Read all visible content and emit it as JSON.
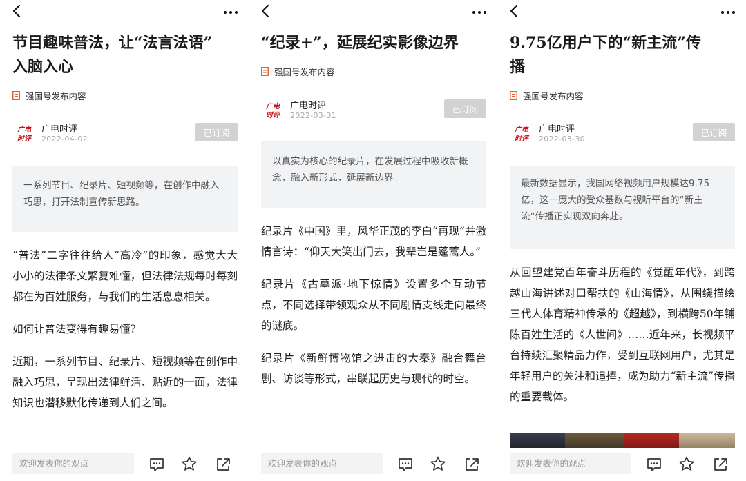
{
  "articles": [
    {
      "title_lines": [
        "节目趣味普法，让“法言法语”",
        "入脑入心"
      ],
      "source_label": "强国号发布内容",
      "author": {
        "name": "广电时评",
        "date": "2022-04-02",
        "avatar_text": [
          "广电",
          "时评"
        ]
      },
      "subscribe_label": "已订阅",
      "summary": "一系列节目、纪录片、短视频等，在创作中融入巧思，打开法制宣传新思路。",
      "paragraphs": [
        "“普法”二字往往给人“高冷”的印象，感觉大大小小的法律条文繁复难懂，但法律法规每时每刻都在为百姓服务，与我们的生活息息相关。",
        "如何让普法变得有趣易懂?",
        "近期，一系列节目、纪录片、短视频等在创作中融入巧思，呈现出法律鲜活、贴近的一面，法律知识也潜移默化传递到人们之间。"
      ],
      "comment_placeholder": "欢迎发表你的观点"
    },
    {
      "title_lines": [
        "“纪录+”，延展纪实影像边界"
      ],
      "source_label": "强国号发布内容",
      "author": {
        "name": "广电时评",
        "date": "2022-03-31",
        "avatar_text": [
          "广电",
          "时评"
        ]
      },
      "subscribe_label": "已订阅",
      "summary": "以真实为核心的纪录片，在发展过程中吸收新概念，融入新形式，延展新边界。",
      "paragraphs": [
        "纪录片《中国》里，风华正茂的李白“再现”并激情言诗：“仰天大笑出门去，我辈岂是蓬蒿人。”",
        "纪录片《古墓派·地下惊情》设置多个互动节点，不同选择带领观众从不同剧情支线走向最终的谜底。",
        "纪录片《新鲜博物馆之进击的大秦》融合舞台剧、访谈等形式，串联起历史与现代的时空。"
      ],
      "comment_placeholder": "欢迎发表你的观点"
    },
    {
      "title_lines": [
        "9.75亿用户下的“新主流”传",
        "播"
      ],
      "source_label": "强国号发布内容",
      "author": {
        "name": "广电时评",
        "date": "2022-03-30",
        "avatar_text": [
          "广电",
          "时评"
        ]
      },
      "subscribe_label": "已订阅",
      "summary": "最新数据显示，我国网络视频用户规模达9.75亿，这一庞大的受众基数与视听平台的“新主流”传播正实现双向奔赴。",
      "paragraphs": [
        "从回望建党百年奋斗历程的《觉醒年代》，到跨越山海讲述对口帮扶的《山海情》，从围绕描绘三代人体育精神传承的《超越》，到横跨50年铺陈百姓生活的《人世间》……近年来，长视频平台持续汇聚精品力作，受到互联网用户，尤其是年轻用户的关注和追捧，成为助力“新主流”传播的重要载体。"
      ],
      "comment_placeholder": "欢迎发表你的观点"
    }
  ],
  "colors": {
    "source_icon": "#e8632b",
    "avatar_red": "#c8161d",
    "subscribe_bg": "#d2d2d2",
    "summary_bg": "#f2f3f5"
  },
  "icons": [
    "back-arrow-icon",
    "more-icon",
    "document-icon",
    "comment-icon",
    "star-icon",
    "share-icon"
  ]
}
